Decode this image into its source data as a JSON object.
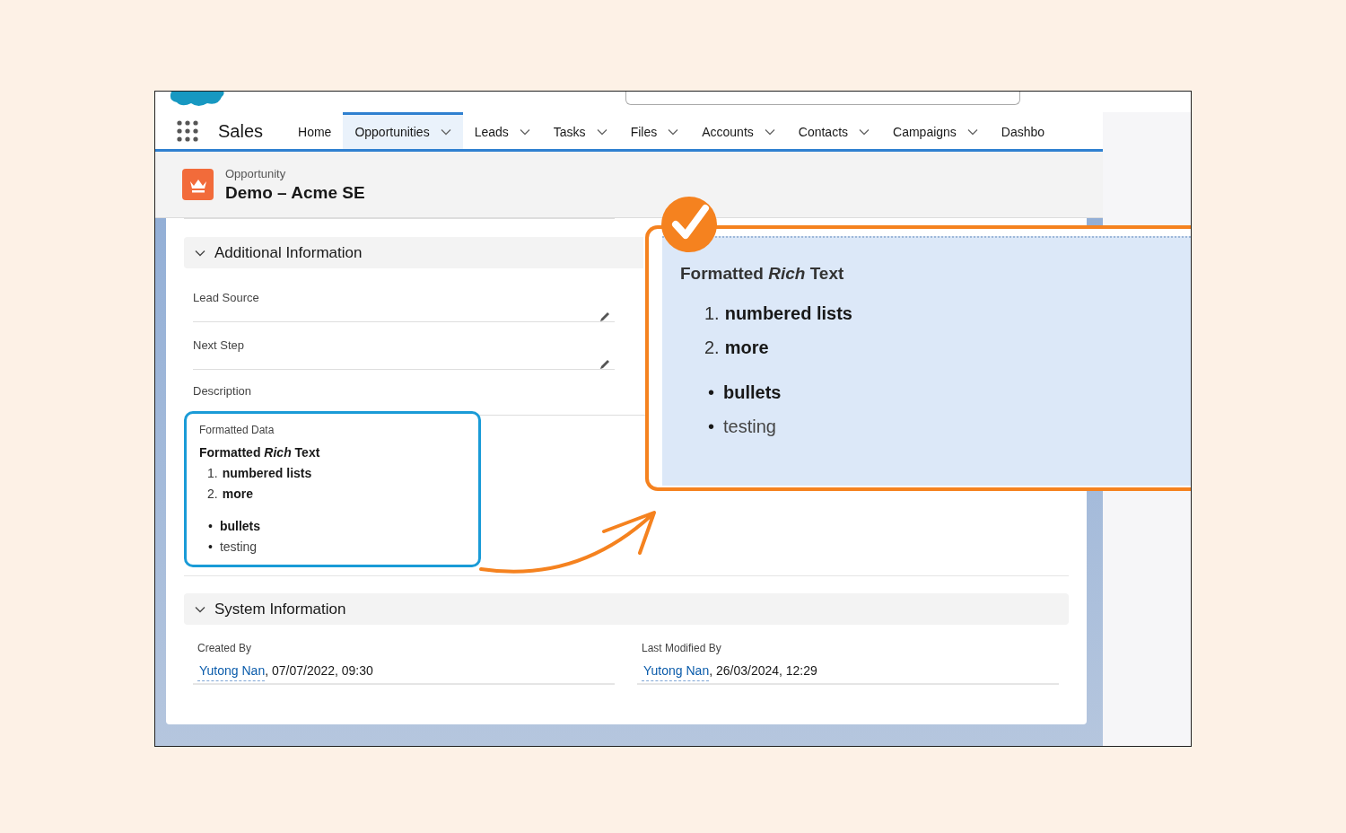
{
  "app": {
    "name": "Sales"
  },
  "nav": [
    {
      "label": "Home",
      "selected": false,
      "has_menu": false
    },
    {
      "label": "Opportunities",
      "selected": true,
      "has_menu": true
    },
    {
      "label": "Leads",
      "selected": false,
      "has_menu": true
    },
    {
      "label": "Tasks",
      "selected": false,
      "has_menu": true
    },
    {
      "label": "Files",
      "selected": false,
      "has_menu": true
    },
    {
      "label": "Accounts",
      "selected": false,
      "has_menu": true
    },
    {
      "label": "Contacts",
      "selected": false,
      "has_menu": true
    },
    {
      "label": "Campaigns",
      "selected": false,
      "has_menu": true
    },
    {
      "label": "Dashbo",
      "selected": false,
      "has_menu": false
    }
  ],
  "record": {
    "type": "Opportunity",
    "name": "Demo – Acme SE"
  },
  "additional_information": {
    "title": "Additional Information",
    "expanded": true,
    "fields": [
      {
        "label": "Lead Source",
        "editable": true
      },
      {
        "label": "Next Step",
        "editable": true
      },
      {
        "label": "Description",
        "editable": false
      }
    ],
    "formatted_data": {
      "label": "Formatted Data",
      "heading": "Formatted *Rich* Text",
      "numbered": [
        {
          "marker": "1.",
          "text": "numbered lists",
          "bold": true
        },
        {
          "marker": "2.",
          "text": "more",
          "bold": true
        }
      ],
      "bullets": [
        {
          "marker": "•",
          "text": "bullets",
          "bold": true
        },
        {
          "marker": "•",
          "text": "testing",
          "bold": false
        }
      ]
    }
  },
  "system_information": {
    "title": "System Information",
    "expanded": true,
    "fields": [
      {
        "label": "Created By",
        "user": "Yutong Nan",
        "value": ", 07/07/2022, 09:30"
      },
      {
        "label": "Last Modified By",
        "user": "Yutong Nan",
        "value": ", 26/03/2024, 12:29"
      }
    ]
  },
  "callout": {
    "heading": "Formatted *Rich* Text",
    "numbered": [
      {
        "marker": "1.",
        "text": "numbered lists",
        "bold": true
      },
      {
        "marker": "2.",
        "text": "more",
        "bold": true
      }
    ],
    "bullets": [
      {
        "marker": "•",
        "text": "bullets",
        "bold": true
      },
      {
        "marker": "•",
        "text": "testing",
        "bold": false
      }
    ]
  }
}
